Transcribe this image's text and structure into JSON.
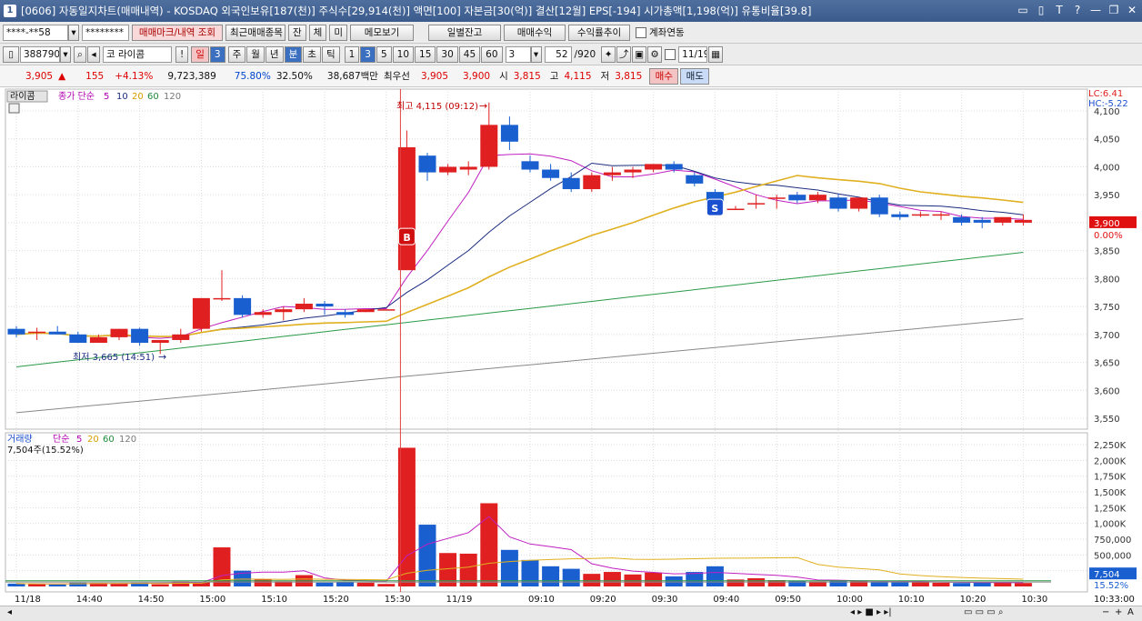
{
  "window": {
    "title": "[0606] 자동일지차트(매매내역) - KOSDAQ 외국인보유[187(천)] 주식수[29,914(천)] 액면[100] 자본금[30(억)] 결산[12월] EPS[-194] 시가총액[1,198(억)] 유통비율[39.8]",
    "num_icon": "1",
    "controls": [
      "▭",
      "▯",
      "T",
      "?",
      "—",
      "❐",
      "✕"
    ]
  },
  "toolbar1": {
    "account": "****-**58",
    "password": "********",
    "trade_mark_btn": "매매마크/내역 조회",
    "recent_btn": "최근매매종목",
    "tab_jan": "잔",
    "tab_che": "체",
    "tab_mi": "미",
    "memo_btn": "메모보기",
    "daily_btn": "일별잔고",
    "trade_profit_btn": "매매수익",
    "yield_btn": "수익률추이",
    "link_label": "계좌연동"
  },
  "toolbar2": {
    "code": "388790",
    "name": "코 라이콤",
    "excl": "!",
    "il_tab": "일",
    "num3": "3",
    "periods": [
      "주",
      "월",
      "년",
      "분",
      "초",
      "틱"
    ],
    "mins": [
      "1",
      "3",
      "5",
      "10",
      "15",
      "30",
      "45",
      "60"
    ],
    "sel_min": "3",
    "count": "52",
    "total": "/920",
    "date": "11/19"
  },
  "quote": {
    "price": "3,905",
    "arrow": "▲",
    "change": "155",
    "pct": "+4.13%",
    "volume": "9,723,389",
    "ratio1": "75.80%",
    "ratio2": "32.50%",
    "amount": "38,687백만",
    "best_ask_label": "최우선",
    "best_ask": "3,905",
    "best_bid": "3,900",
    "open_label": "시",
    "open": "3,815",
    "high_label": "고",
    "high": "4,115",
    "low_label": "저",
    "low": "3,815",
    "buy_btn": "매수",
    "sell_btn": "매도"
  },
  "chart_data": {
    "type": "candlestick",
    "price_legend": {
      "name": "라이콤",
      "ma_label": "종가 단순",
      "periods": [
        "5",
        "10",
        "20",
        "60",
        "120"
      ]
    },
    "volume_legend": {
      "name": "거래량",
      "ma_label": "단순",
      "periods": [
        "5",
        "20",
        "60",
        "120"
      ],
      "current": "7,504주(15.52%)"
    },
    "lc": "LC:6.41",
    "hc": "HC:-5.22",
    "price_axis": {
      "min": 3550,
      "max": 4100,
      "ticks": [
        "4,100",
        "4,050",
        "4,000",
        "3,950",
        "3,900",
        "3,850",
        "3,800",
        "3,750",
        "3,700",
        "3,650",
        "3,600",
        "3,550"
      ]
    },
    "volume_axis": {
      "max": 2250000,
      "ticks": [
        "2,250K",
        "2,000K",
        "1,750K",
        "1,500K",
        "1,250K",
        "1,000K",
        "750,000",
        "500,000",
        "250,000"
      ]
    },
    "current_price_tag": "3,900",
    "current_pct_tag": "0.00%",
    "volume_tag": "7,504",
    "volume_pct_tag": "15.52%",
    "time_label": "10:33:00",
    "x_labels": [
      "11/18",
      "14:40",
      "14:50",
      "15:00",
      "15:10",
      "15:20",
      "15:30",
      "11/19",
      "09:10",
      "09:20",
      "09:30",
      "09:40",
      "09:50",
      "10:00",
      "10:10",
      "10:20",
      "10:30"
    ],
    "annotations": {
      "high": "최고 4,115 (09:12)",
      "low": "최저 3,665 (14:51)",
      "buy_mark": "B",
      "sell_mark": "S"
    },
    "candles": [
      {
        "o": 3710,
        "h": 3715,
        "c": 3700,
        "l": 3695
      },
      {
        "o": 3705,
        "h": 3712,
        "c": 3705,
        "l": 3690
      },
      {
        "o": 3705,
        "h": 3715,
        "c": 3700,
        "l": 3700
      },
      {
        "o": 3700,
        "h": 3705,
        "c": 3685,
        "l": 3685
      },
      {
        "o": 3685,
        "h": 3700,
        "c": 3695,
        "l": 3685
      },
      {
        "o": 3695,
        "h": 3710,
        "c": 3710,
        "l": 3690
      },
      {
        "o": 3710,
        "h": 3712,
        "c": 3685,
        "l": 3680
      },
      {
        "o": 3685,
        "h": 3690,
        "c": 3690,
        "l": 3665
      },
      {
        "o": 3690,
        "h": 3710,
        "c": 3700,
        "l": 3685
      },
      {
        "o": 3710,
        "h": 3765,
        "c": 3765,
        "l": 3705
      },
      {
        "o": 3765,
        "h": 3815,
        "c": 3765,
        "l": 3760
      },
      {
        "o": 3765,
        "h": 3770,
        "c": 3735,
        "l": 3730
      },
      {
        "o": 3735,
        "h": 3745,
        "c": 3740,
        "l": 3730
      },
      {
        "o": 3740,
        "h": 3750,
        "c": 3745,
        "l": 3725
      },
      {
        "o": 3745,
        "h": 3765,
        "c": 3755,
        "l": 3740
      },
      {
        "o": 3755,
        "h": 3760,
        "c": 3750,
        "l": 3735
      },
      {
        "o": 3740,
        "h": 3745,
        "c": 3735,
        "l": 3730
      },
      {
        "o": 3740,
        "h": 3745,
        "c": 3745,
        "l": 3740
      },
      {
        "o": 3745,
        "h": 3745,
        "c": 3745,
        "l": 3745
      },
      {
        "o": 3815,
        "h": 4065,
        "c": 4035,
        "l": 3815
      },
      {
        "o": 4020,
        "h": 4025,
        "c": 3990,
        "l": 3975
      },
      {
        "o": 3990,
        "h": 4005,
        "c": 4000,
        "l": 3985
      },
      {
        "o": 3995,
        "h": 4010,
        "c": 4000,
        "l": 3985
      },
      {
        "o": 4000,
        "h": 4115,
        "c": 4075,
        "l": 3995
      },
      {
        "o": 4075,
        "h": 4090,
        "c": 4045,
        "l": 4030
      },
      {
        "o": 4010,
        "h": 4020,
        "c": 3995,
        "l": 3990
      },
      {
        "o": 3995,
        "h": 4005,
        "c": 3980,
        "l": 3975
      },
      {
        "o": 3980,
        "h": 3990,
        "c": 3960,
        "l": 3955
      },
      {
        "o": 3960,
        "h": 3990,
        "c": 3985,
        "l": 3955
      },
      {
        "o": 3985,
        "h": 4000,
        "c": 3990,
        "l": 3975
      },
      {
        "o": 3990,
        "h": 4000,
        "c": 3995,
        "l": 3980
      },
      {
        "o": 3995,
        "h": 4005,
        "c": 4005,
        "l": 3990
      },
      {
        "o": 4005,
        "h": 4010,
        "c": 3995,
        "l": 3990
      },
      {
        "o": 3985,
        "h": 3990,
        "c": 3970,
        "l": 3965
      },
      {
        "o": 3955,
        "h": 3960,
        "c": 3925,
        "l": 3920
      },
      {
        "o": 3925,
        "h": 3930,
        "c": 3925,
        "l": 3925
      },
      {
        "o": 3935,
        "h": 3950,
        "c": 3935,
        "l": 3925
      },
      {
        "o": 3945,
        "h": 3950,
        "c": 3945,
        "l": 3925
      },
      {
        "o": 3950,
        "h": 3955,
        "c": 3940,
        "l": 3935
      },
      {
        "o": 3940,
        "h": 3955,
        "c": 3950,
        "l": 3935
      },
      {
        "o": 3945,
        "h": 3950,
        "c": 3925,
        "l": 3920
      },
      {
        "o": 3925,
        "h": 3945,
        "c": 3945,
        "l": 3920
      },
      {
        "o": 3945,
        "h": 3950,
        "c": 3915,
        "l": 3910
      },
      {
        "o": 3915,
        "h": 3920,
        "c": 3910,
        "l": 3905
      },
      {
        "o": 3915,
        "h": 3920,
        "c": 3915,
        "l": 3910
      },
      {
        "o": 3915,
        "h": 3920,
        "c": 3915,
        "l": 3905
      },
      {
        "o": 3910,
        "h": 3915,
        "c": 3900,
        "l": 3895
      },
      {
        "o": 3905,
        "h": 3910,
        "c": 3900,
        "l": 3890
      },
      {
        "o": 3900,
        "h": 3905,
        "c": 3910,
        "l": 3895
      },
      {
        "o": 3900,
        "h": 3915,
        "c": 3905,
        "l": 3895
      }
    ],
    "volumes": [
      45000,
      40000,
      30000,
      60000,
      55000,
      50000,
      60000,
      35000,
      80000,
      70000,
      620000,
      250000,
      110000,
      80000,
      180000,
      60000,
      70000,
      60000,
      40000,
      2200000,
      980000,
      530000,
      520000,
      1320000,
      580000,
      420000,
      320000,
      280000,
      200000,
      230000,
      190000,
      220000,
      160000,
      230000,
      320000,
      110000,
      130000,
      100000,
      90000,
      80000,
      100000,
      85000,
      75000,
      70000,
      65000,
      60000,
      55000,
      65000,
      60000,
      55000
    ]
  },
  "status": {
    "time": "10:33:00",
    "zoom_minus": "−",
    "zoom_plus": "+",
    "label_a": "A"
  }
}
